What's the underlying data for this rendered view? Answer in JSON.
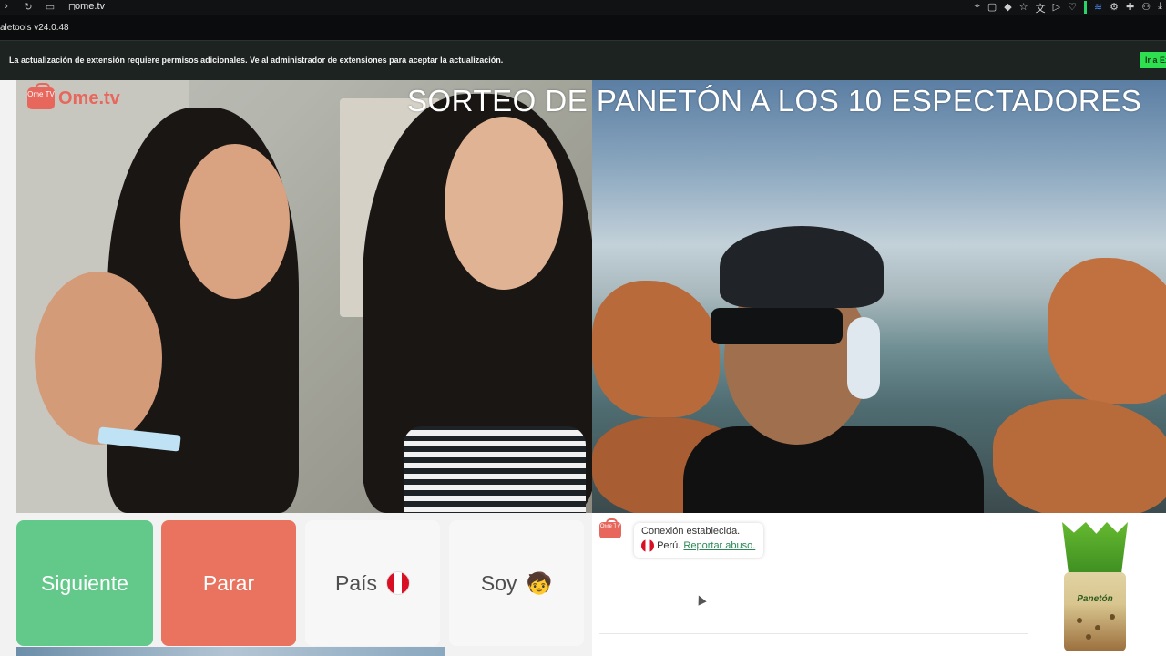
{
  "browser": {
    "url": "ome.tv",
    "extension_name": "aletools v24.0.48"
  },
  "notice": {
    "message": "La actualización de extensión requiere permisos adicionales. Ve al administrador de extensiones para aceptar la actualización.",
    "button_label": "Ir a Ex"
  },
  "app": {
    "logo_text": "Ome.tv",
    "logo_icon_text": "Ome TV",
    "overlay_title": "SORTEO DE PANETÓN A LOS 10 ESPECTADORES",
    "controls": {
      "next_label": "Siguiente",
      "stop_label": "Parar",
      "country_label": "País",
      "me_label": "Soy",
      "me_emoji": "🧒"
    },
    "chat": {
      "status": "Conexión establecida.",
      "country": "Perú.",
      "report_link": "Reportar abuso."
    },
    "product": {
      "label": "Panetón"
    }
  },
  "colors": {
    "next": "#63c98a",
    "stop": "#e9735f",
    "brand": "#e7675c",
    "link": "#2a8a55"
  }
}
